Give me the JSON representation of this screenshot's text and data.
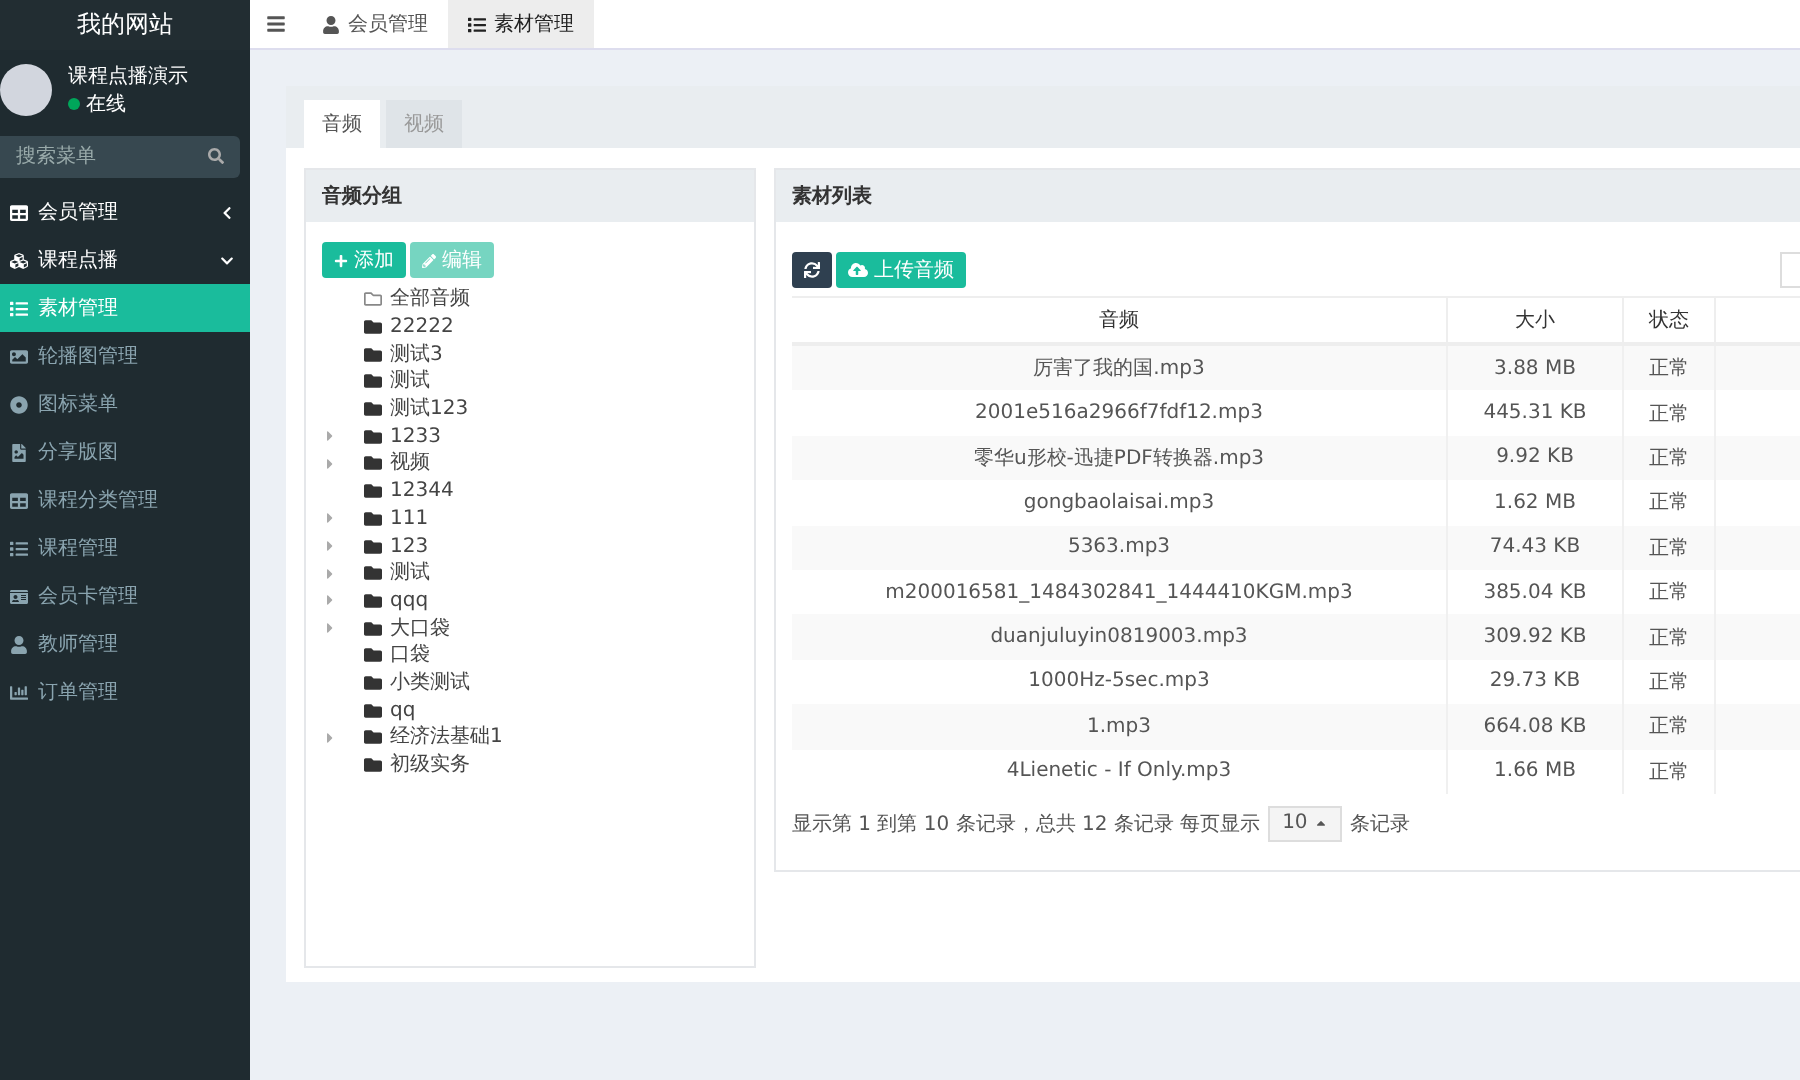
{
  "sidebar": {
    "brand": "我的网站",
    "user": {
      "name": "课程点播演示",
      "status": "在线"
    },
    "search": {
      "placeholder": "搜索菜单"
    },
    "items": [
      {
        "label": "会员管理",
        "kind": "submenu",
        "expanded": false,
        "selected": false
      },
      {
        "label": "课程点播",
        "kind": "submenu",
        "expanded": true,
        "selected": false
      },
      {
        "label": "素材管理",
        "kind": "link",
        "selected": true
      },
      {
        "label": "轮播图管理",
        "kind": "link",
        "selected": false
      },
      {
        "label": "图标菜单",
        "kind": "link",
        "selected": false
      },
      {
        "label": "分享版图",
        "kind": "link",
        "selected": false
      },
      {
        "label": "课程分类管理",
        "kind": "link",
        "selected": false
      },
      {
        "label": "课程管理",
        "kind": "link",
        "selected": false
      },
      {
        "label": "会员卡管理",
        "kind": "link",
        "selected": false
      },
      {
        "label": "教师管理",
        "kind": "link",
        "selected": false
      },
      {
        "label": "订单管理",
        "kind": "link",
        "selected": false
      }
    ]
  },
  "header": {
    "tabs": [
      {
        "label": "会员管理",
        "selected": false
      },
      {
        "label": "素材管理",
        "selected": true
      }
    ]
  },
  "content_tabs": [
    {
      "label": "音频",
      "selected": true
    },
    {
      "label": "视频",
      "selected": false
    }
  ],
  "groups": {
    "title": "音频分组",
    "buttons": [
      {
        "label": "添加",
        "disabled": false
      },
      {
        "label": "编辑",
        "disabled": true
      }
    ],
    "tree": [
      {
        "label": "全部音频",
        "kind": "all",
        "expandable": false
      },
      {
        "label": "22222",
        "kind": "folder",
        "expandable": false
      },
      {
        "label": "测试3",
        "kind": "folder",
        "expandable": false
      },
      {
        "label": "测试",
        "kind": "folder",
        "expandable": false
      },
      {
        "label": "测试123",
        "kind": "folder",
        "expandable": false
      },
      {
        "label": "1233",
        "kind": "folder",
        "expandable": true
      },
      {
        "label": "视频",
        "kind": "folder",
        "expandable": true
      },
      {
        "label": "12344",
        "kind": "folder",
        "expandable": false
      },
      {
        "label": "111",
        "kind": "folder",
        "expandable": true
      },
      {
        "label": "123",
        "kind": "folder",
        "expandable": true
      },
      {
        "label": "测试",
        "kind": "folder",
        "expandable": true
      },
      {
        "label": "qqq",
        "kind": "folder",
        "expandable": true
      },
      {
        "label": "大口袋",
        "kind": "folder",
        "expandable": true
      },
      {
        "label": "口袋",
        "kind": "folder",
        "expandable": false
      },
      {
        "label": "小类测试",
        "kind": "folder",
        "expandable": false
      },
      {
        "label": "qq",
        "kind": "folder",
        "expandable": false
      },
      {
        "label": "经济法基础1",
        "kind": "folder",
        "expandable": true
      },
      {
        "label": "初级实务",
        "kind": "folder",
        "expandable": false
      }
    ]
  },
  "materials": {
    "title": "素材列表",
    "upload_button": "上传音频",
    "columns": [
      "音频",
      "大小",
      "状态"
    ],
    "rows": [
      [
        "厉害了我的国.mp3",
        "3.88 MB",
        "正常"
      ],
      [
        "2001e516a2966f7fdf12.mp3",
        "445.31 KB",
        "正常"
      ],
      [
        "零华u形校-迅捷PDF转换器.mp3",
        "9.92 KB",
        "正常"
      ],
      [
        "gongbaolaisai.mp3",
        "1.62 MB",
        "正常"
      ],
      [
        "5363.mp3",
        "74.43 KB",
        "正常"
      ],
      [
        "m200016581_1484302841_1444410KGM.mp3",
        "385.04 KB",
        "正常"
      ],
      [
        "duanjuluyin0819003.mp3",
        "309.92 KB",
        "正常"
      ],
      [
        "1000Hz-5sec.mp3",
        "29.73 KB",
        "正常"
      ],
      [
        "1.mp3",
        "664.08 KB",
        "正常"
      ],
      [
        "4Lienetic - If Only.mp3",
        "1.66 MB",
        "正常"
      ]
    ],
    "footer": {
      "summary": "显示第 1 到第 10 条记录，总共 12 条记录 每页显示",
      "page_size": "10",
      "suffix": "条记录"
    }
  }
}
